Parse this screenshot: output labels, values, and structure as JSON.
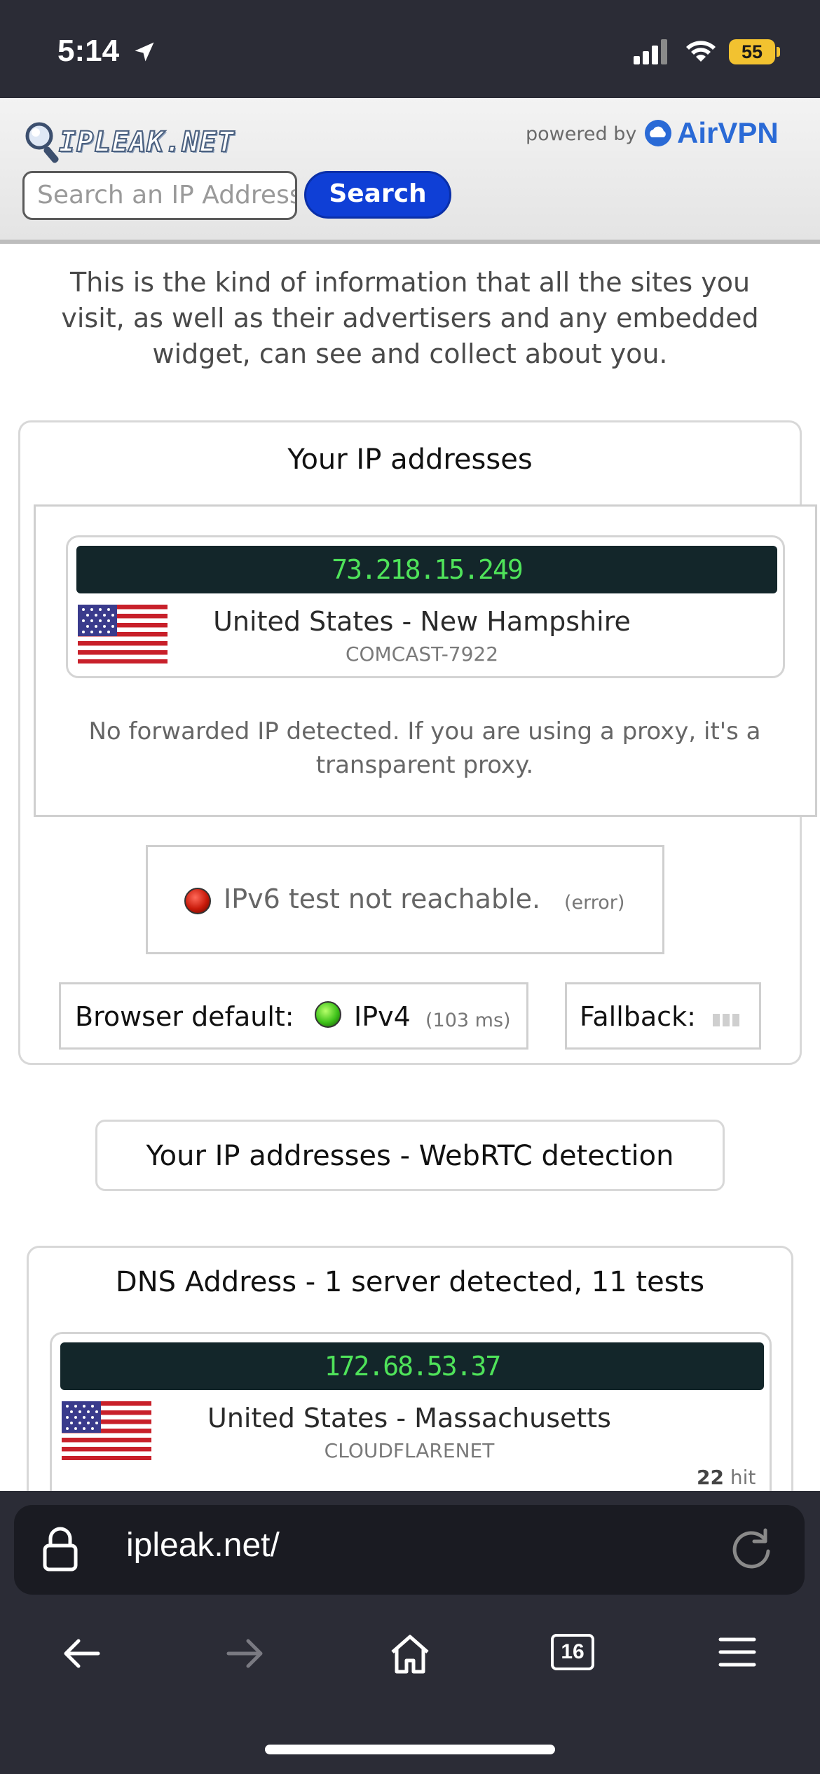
{
  "status_bar": {
    "time": "5:14",
    "battery": "55"
  },
  "header": {
    "logo_text": "IPLEAK.NET",
    "powered_by": "powered by",
    "brand": "AirVPN",
    "search_placeholder": "Search an IP Address",
    "search_button": "Search"
  },
  "intro": "This is the kind of information that all the sites you visit, as well as their advertisers and any embedded widget, can see and collect about you.",
  "ip_panel": {
    "title": "Your IP addresses",
    "ip": "73.218.15.249",
    "location": "United States - New Hampshire",
    "isp": "COMCAST-7922",
    "forward_note": "No forwarded IP detected. If you are using a proxy, it's a transparent proxy.",
    "ipv6_text": "IPv6 test not reachable.",
    "ipv6_status": "(error)",
    "browser_default_label": "Browser default:",
    "browser_default_proto": "IPv4",
    "browser_default_ms": "(103 ms)",
    "fallback_label": "Fallback:"
  },
  "webrtc_button": "Your IP addresses - WebRTC detection",
  "dns_panel": {
    "title": "DNS Address - 1 server detected, 11 tests",
    "ip": "172.68.53.37",
    "location": "United States - Massachusetts",
    "isp": "CLOUDFLARENET",
    "hit_count": "22",
    "hit_label": "hit"
  },
  "browser": {
    "url": "ipleak.net/",
    "tabs_count": "16"
  },
  "colors": {
    "search_button": "#0f3fd6",
    "ip_bar": "#13262a",
    "ip_text": "#4fe35a",
    "brand": "#2a6ad6"
  }
}
